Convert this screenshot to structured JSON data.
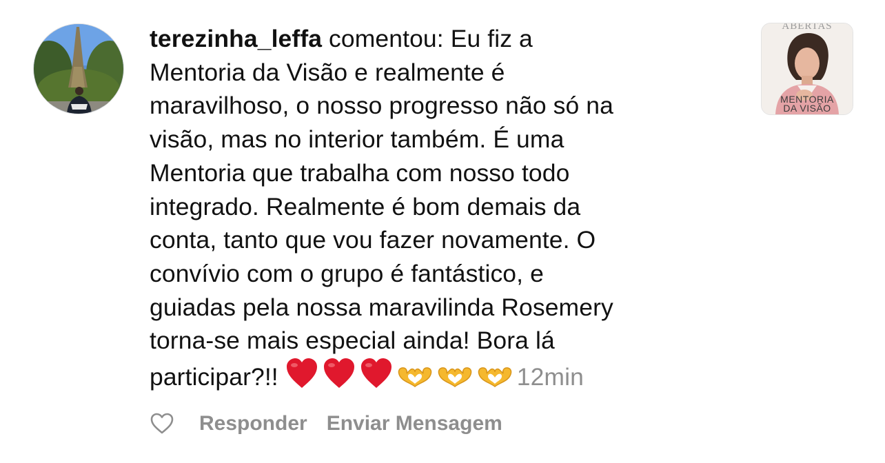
{
  "comment": {
    "username": "terezinha_leffa",
    "verb": " comentou:",
    "lines": [
      " Eu fiz a",
      "Mentoria da Visão e realmente é",
      "maravilhoso, o nosso progresso não só na",
      "visão, mas no interior também. É uma",
      "Mentoria que trabalha com nosso todo",
      "integrado. Realmente é bom demais da",
      "conta, tanto que vou fazer novamente. O",
      "convívio com o grupo é fantástico, e",
      "guiadas pela nossa maravilinda Rosemery",
      "torna-se mais especial ainda! Bora lá"
    ],
    "last_line_text": "participar?!! ",
    "emojis": [
      "red-heart",
      "red-heart",
      "red-heart",
      "heart-hands",
      "heart-hands",
      "heart-hands"
    ],
    "timestamp": "12min"
  },
  "thumbnail": {
    "top_text": "ABERTAS",
    "caption_line1": "MENTORIA",
    "caption_line2": "DA VISÃO"
  },
  "actions": {
    "like_icon": "heart-outline-icon",
    "reply": "Responder",
    "send_message": "Enviar Mensagem"
  },
  "colors": {
    "text": "#111111",
    "muted": "#8e8e8e",
    "heart_red": "#e0182d",
    "heart_hands": "#f5b82e"
  }
}
